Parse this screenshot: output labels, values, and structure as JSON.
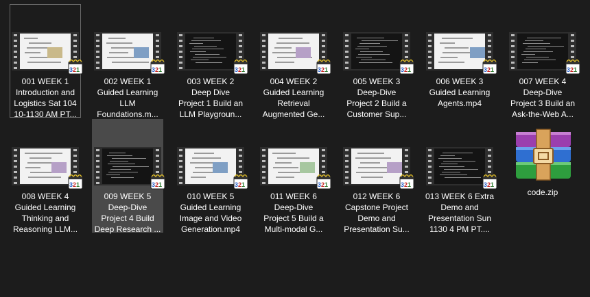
{
  "files": [
    {
      "name": [
        "001 WEEK 1",
        "Introduction and",
        "Logistics Sat 104",
        "10-1130 AM PT..."
      ],
      "type": "video",
      "thumb": "light"
    },
    {
      "name": [
        "002 WEEK 1",
        "Guided Learning",
        "LLM",
        "Foundations.m..."
      ],
      "type": "video",
      "thumb": "light"
    },
    {
      "name": [
        "003 WEEK 2",
        "Deep Dive",
        "Project 1 Build an",
        "LLM Playgroun..."
      ],
      "type": "video",
      "thumb": "dark"
    },
    {
      "name": [
        "004 WEEK 2",
        "Guided Learning",
        "Retrieval",
        "Augmented Ge..."
      ],
      "type": "video",
      "thumb": "light"
    },
    {
      "name": [
        "005 WEEK 3",
        "Deep-Dive",
        "Project 2 Build a",
        "Customer Sup..."
      ],
      "type": "video",
      "thumb": "dark"
    },
    {
      "name": [
        "006 WEEK 3",
        "Guided Learning",
        "Agents.mp4"
      ],
      "type": "video",
      "thumb": "light"
    },
    {
      "name": [
        "007 WEEK 4",
        "Deep-Dive",
        "Project 3 Build an",
        "Ask-the-Web A..."
      ],
      "type": "video",
      "thumb": "dark"
    },
    {
      "name": [
        "008 WEEK 4",
        "Guided Learning",
        "Thinking and",
        "Reasoning LLM..."
      ],
      "type": "video",
      "thumb": "light"
    },
    {
      "name": [
        "009 WEEK 5",
        "Deep-Dive",
        "Project 4 Build",
        "Deep Research ..."
      ],
      "type": "video",
      "thumb": "dark"
    },
    {
      "name": [
        "010 WEEK 5",
        "Guided Learning",
        "Image and Video",
        "Generation.mp4"
      ],
      "type": "video",
      "thumb": "light"
    },
    {
      "name": [
        "011 WEEK 6",
        "Deep-Dive",
        "Project 5 Build a",
        "Multi-modal G..."
      ],
      "type": "video",
      "thumb": "light"
    },
    {
      "name": [
        "012 WEEK 6",
        "Capstone Project",
        "Demo and",
        "Presentation Su..."
      ],
      "type": "video",
      "thumb": "light"
    },
    {
      "name": [
        "013 WEEK 6 Extra",
        "Demo and",
        "Presentation Sun",
        "1130 4 PM PT...."
      ],
      "type": "video",
      "thumb": "dark"
    },
    {
      "name": [
        "code.zip"
      ],
      "type": "zip",
      "thumb": "winrar-icon"
    }
  ],
  "badge_text": "321",
  "colors": {
    "background": "#1c1c1c",
    "selected": "#4a4a4a",
    "focus_border": "#6b6b6b",
    "text": "#ffffff"
  }
}
